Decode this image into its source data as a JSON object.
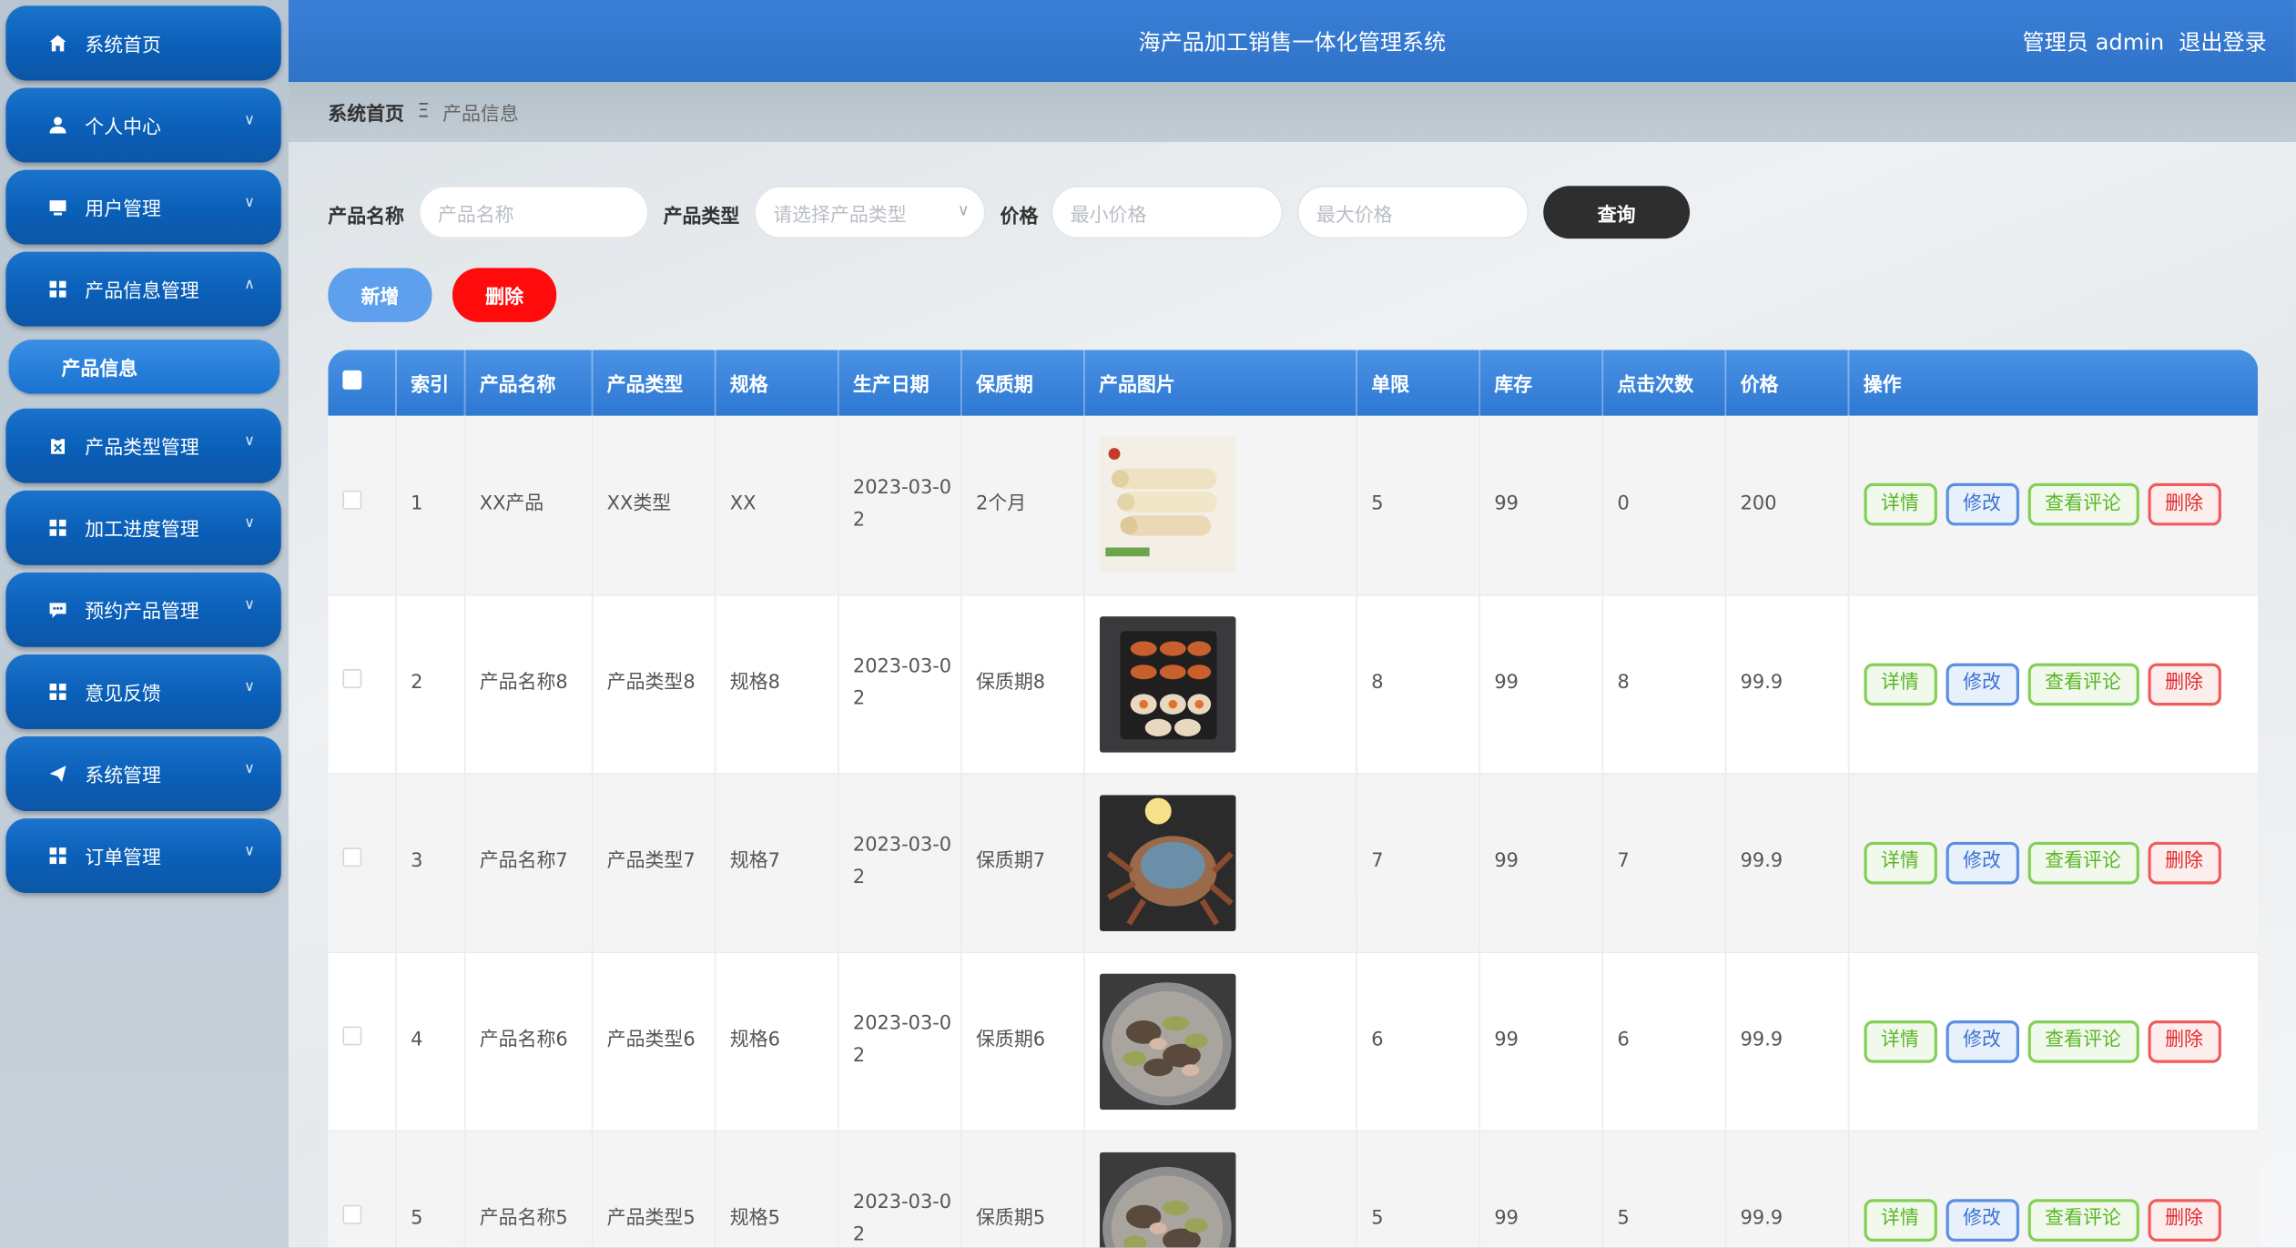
{
  "header": {
    "title": "海产品加工销售一体化管理系统",
    "user": "管理员 admin",
    "logout": "退出登录"
  },
  "sidebar": {
    "items": [
      {
        "label": "系统首页",
        "icon": "home-icon"
      },
      {
        "label": "个人中心",
        "icon": "user-icon"
      },
      {
        "label": "用户管理",
        "icon": "monitor-icon"
      },
      {
        "label": "产品信息管理",
        "icon": "grid-icon"
      },
      {
        "label": "产品类型管理",
        "icon": "clipboard-icon"
      },
      {
        "label": "加工进度管理",
        "icon": "grid-icon"
      },
      {
        "label": "预约产品管理",
        "icon": "chat-icon"
      },
      {
        "label": "意见反馈",
        "icon": "grid-icon"
      },
      {
        "label": "系统管理",
        "icon": "send-icon"
      },
      {
        "label": "订单管理",
        "icon": "grid-icon"
      }
    ],
    "sub_item": "产品信息"
  },
  "breadcrumb": {
    "home": "系统首页",
    "separator": "Ξ",
    "current": "产品信息"
  },
  "search": {
    "name_label": "产品名称",
    "name_placeholder": "产品名称",
    "type_label": "产品类型",
    "type_placeholder": "请选择产品类型",
    "price_label": "价格",
    "min_price_placeholder": "最小价格",
    "max_price_placeholder": "最大价格",
    "query_button": "查询"
  },
  "actions": {
    "add": "新增",
    "delete": "删除"
  },
  "table": {
    "columns": [
      "索引",
      "产品名称",
      "产品类型",
      "规格",
      "生产日期",
      "保质期",
      "产品图片",
      "单限",
      "库存",
      "点击次数",
      "价格",
      "操作"
    ],
    "op_labels": {
      "detail": "详情",
      "edit": "修改",
      "review": "查看评论",
      "remove": "删除"
    },
    "rows": [
      {
        "index": "1",
        "name": "XX产品",
        "type": "XX类型",
        "spec": "XX",
        "date": "2023-03-02",
        "shelf": "2个月",
        "limit": "5",
        "stock": "99",
        "clicks": "0",
        "price": "200"
      },
      {
        "index": "2",
        "name": "产品名称8",
        "type": "产品类型8",
        "spec": "规格8",
        "date": "2023-03-02",
        "shelf": "保质期8",
        "limit": "8",
        "stock": "99",
        "clicks": "8",
        "price": "99.9"
      },
      {
        "index": "3",
        "name": "产品名称7",
        "type": "产品类型7",
        "spec": "规格7",
        "date": "2023-03-02",
        "shelf": "保质期7",
        "limit": "7",
        "stock": "99",
        "clicks": "7",
        "price": "99.9"
      },
      {
        "index": "4",
        "name": "产品名称6",
        "type": "产品类型6",
        "spec": "规格6",
        "date": "2023-03-02",
        "shelf": "保质期6",
        "limit": "6",
        "stock": "99",
        "clicks": "6",
        "price": "99.9"
      },
      {
        "index": "5",
        "name": "产品名称5",
        "type": "产品类型5",
        "spec": "规格5",
        "date": "2023-03-02",
        "shelf": "保质期5",
        "limit": "5",
        "stock": "99",
        "clicks": "5",
        "price": "99.9"
      }
    ]
  }
}
